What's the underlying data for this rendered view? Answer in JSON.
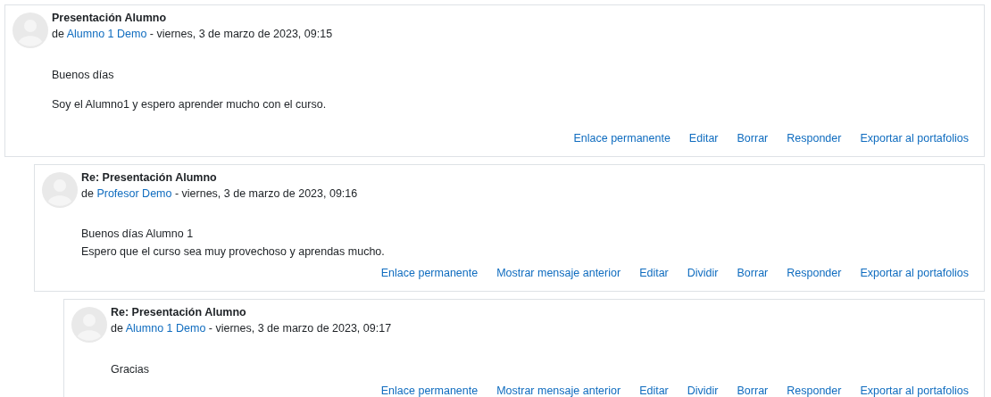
{
  "posts": [
    {
      "subject": "Presentación Alumno",
      "by_prefix": "de",
      "author": "Alumno 1 Demo",
      "date": " - viernes, 3 de marzo de 2023, 09:15",
      "message": [
        [
          "Buenos días"
        ],
        [
          "Soy el Alumno1 y espero aprender mucho con el curso."
        ]
      ],
      "actions": [
        "Enlace permanente",
        "Editar",
        "Borrar",
        "Responder",
        "Exportar al portafolios"
      ],
      "children": [
        {
          "subject": "Re: Presentación Alumno",
          "by_prefix": "de",
          "author": "Profesor Demo",
          "date": " - viernes, 3 de marzo de 2023, 09:16",
          "message": [
            [
              "Buenos días Alumno 1",
              "Espero que el curso sea muy provechoso y aprendas mucho."
            ]
          ],
          "actions": [
            "Enlace permanente",
            "Mostrar mensaje anterior",
            "Editar",
            "Dividir",
            "Borrar",
            "Responder",
            "Exportar al portafolios"
          ],
          "children": [
            {
              "subject": "Re: Presentación Alumno",
              "by_prefix": "de",
              "author": "Alumno 1 Demo",
              "date": " - viernes, 3 de marzo de 2023, 09:17",
              "message": [
                [
                  "Gracias"
                ]
              ],
              "actions": [
                "Enlace permanente",
                "Mostrar mensaje anterior",
                "Editar",
                "Dividir",
                "Borrar",
                "Responder",
                "Exportar al portafolios"
              ]
            }
          ]
        }
      ]
    }
  ]
}
